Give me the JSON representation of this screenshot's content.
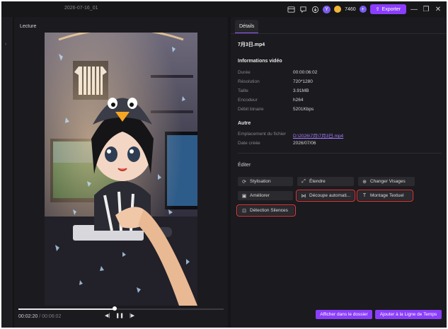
{
  "titlebar": {
    "date": "2026-07-16_01",
    "avatar_letter": "Y",
    "credits": "7460",
    "export_label": "Exporter"
  },
  "player": {
    "title": "Lecture",
    "current_time": "00:02:20",
    "separator": " / ",
    "duration": "00:06:02",
    "progress_fraction": 0.47
  },
  "details": {
    "tab_label": "Détails",
    "filename": "7月3日.mp4",
    "video_info": {
      "title": "Informations vidéo",
      "rows": [
        {
          "label": "Durée",
          "value": "00:00:06:02"
        },
        {
          "label": "Résolution",
          "value": "720*1280"
        },
        {
          "label": "Taille",
          "value": "3.91MB"
        },
        {
          "label": "Encodeur",
          "value": "h264"
        },
        {
          "label": "Débit binaire",
          "value": "5201Kbps"
        }
      ]
    },
    "other": {
      "title": "Autre",
      "location_label": "Emplacement du fichier",
      "location_value": "D:\\2026\\7月\\7月3日.mp4",
      "date_label": "Date créée",
      "date_value": "2026/07/06"
    },
    "edit": {
      "title": "Éditer",
      "buttons": [
        {
          "label": "Stylisation",
          "icon": "stylize-icon"
        },
        {
          "label": "Étendre",
          "icon": "expand-icon"
        },
        {
          "label": "Changer Visages",
          "icon": "face-swap-icon"
        },
        {
          "label": "Améliorer",
          "icon": "enhance-icon"
        },
        {
          "label": "Découpe automati...",
          "icon": "auto-cut-icon"
        },
        {
          "label": "Montage Textuel",
          "icon": "text-edit-icon"
        },
        {
          "label": "Détection Silences",
          "icon": "silence-detect-icon"
        }
      ]
    },
    "footer": {
      "show_in_folder": "Afficher dans le dossier",
      "add_to_timeline": "Ajouter à la Ligne de Temps"
    }
  },
  "colors": {
    "accent": "#8b3dfc",
    "highlight": "#e23b3b",
    "link": "#a87bff"
  }
}
